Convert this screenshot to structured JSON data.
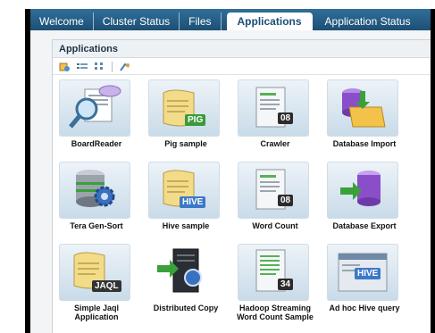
{
  "nav": {
    "tabs": [
      {
        "label": "Welcome",
        "active": false
      },
      {
        "label": "Cluster Status",
        "active": false
      },
      {
        "label": "Files",
        "active": false
      },
      {
        "label": "Applications",
        "active": true
      },
      {
        "label": "Application Status",
        "active": false
      }
    ]
  },
  "panel": {
    "title": "Applications",
    "toolbar": [
      "refresh-icon",
      "list-view-icon",
      "tile-view-icon",
      "settings-icon"
    ]
  },
  "apps": [
    {
      "label": "BoardReader",
      "icon": "magnifier-document-icon"
    },
    {
      "label": "Pig sample",
      "icon": "scroll-pig-icon",
      "badge": "PIG"
    },
    {
      "label": "Crawler",
      "icon": "document-08-icon",
      "badge": "08"
    },
    {
      "label": "Database Import",
      "icon": "database-import-icon"
    },
    {
      "label": "Tera Gen-Sort",
      "icon": "database-gear-icon"
    },
    {
      "label": "Hive sample",
      "icon": "scroll-hive-icon",
      "badge": "HIVE"
    },
    {
      "label": "Word Count",
      "icon": "document-08-icon",
      "badge": "08"
    },
    {
      "label": "Database Export",
      "icon": "database-export-icon"
    },
    {
      "label": "Simple Jaql Application",
      "icon": "scroll-jaql-icon",
      "badge": "JAQL"
    },
    {
      "label": "Distributed Copy",
      "icon": "server-copy-icon"
    },
    {
      "label": "Hadoop Streaming Word Count Sample",
      "icon": "document-34-icon",
      "badge": "34"
    },
    {
      "label": "Ad hoc Hive query",
      "icon": "hive-window-icon",
      "badge": "HIVE"
    }
  ],
  "colors": {
    "nav_bg": "#2f6f9a",
    "active_tab_text": "#1a4f75",
    "pig_badge": "#3a9a3a",
    "hive_badge": "#3c78c8",
    "jaql_badge": "#333333",
    "db_purple": "#8a4fc8"
  }
}
